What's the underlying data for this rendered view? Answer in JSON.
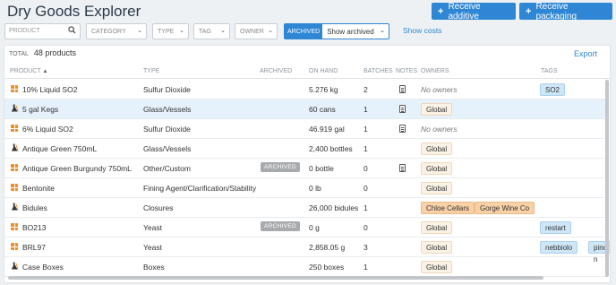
{
  "header": {
    "title": "Dry Goods Explorer",
    "receive_additive": "Receive additive",
    "receive_packaging": "Receive packaging"
  },
  "filters": {
    "search_placeholder": "PRODUCT",
    "category": "CATEGORY",
    "type": "TYPE",
    "tag": "TAG",
    "owner": "OWNER",
    "archived_label": "ARCHIVED",
    "archived_value": "Show archived",
    "show_costs": "Show costs"
  },
  "summary": {
    "total_label": "TOTAL",
    "total_value": "48 products",
    "export": "Export"
  },
  "columns": {
    "product": "PRODUCT",
    "sort_arrow": "▲",
    "type": "TYPE",
    "archived": "ARCHIVED",
    "on_hand": "ON HAND",
    "batches": "BATCHES",
    "notes": "NOTES",
    "owners": "OWNERS",
    "tags": "TAGS"
  },
  "rows": [
    {
      "name": "10% Liquid SO2",
      "icon": "grid-icon",
      "type": "Sulfur Dioxide",
      "archived": "",
      "on_hand": "5.276 kg",
      "batches": "2",
      "note": true,
      "owners": [],
      "no_owners": "No owners",
      "tags": [
        "SO2"
      ]
    },
    {
      "name": "5 gal Kegs",
      "icon": "flask-icon",
      "type": "Glass/Vessels",
      "archived": "",
      "on_hand": "60 cans",
      "batches": "1",
      "note": true,
      "owners": [
        "Global"
      ],
      "tags": []
    },
    {
      "name": "6% Liquid SO2",
      "icon": "grid-icon",
      "type": "Sulfur Dioxide",
      "archived": "",
      "on_hand": "46.919 gal",
      "batches": "1",
      "note": true,
      "owners": [],
      "no_owners": "No owners",
      "tags": []
    },
    {
      "name": "Antique Green 750mL",
      "icon": "flask-icon",
      "type": "Glass/Vessels",
      "archived": "",
      "on_hand": "2,400 bottles",
      "batches": "1",
      "note": false,
      "owners": [
        "Global"
      ],
      "tags": []
    },
    {
      "name": "Antique Green Burgundy 750mL",
      "icon": "grid-icon",
      "type": "Other/Custom",
      "archived": "ARCHIVED",
      "on_hand": "0 bottle",
      "batches": "0",
      "note": true,
      "owners": [
        "Global"
      ],
      "tags": []
    },
    {
      "name": "Bentonite",
      "icon": "grid-icon",
      "type": "Fining Agent/Clarification/Stability",
      "archived": "",
      "on_hand": "0 lb",
      "batches": "0",
      "note": false,
      "owners": [
        "Global"
      ],
      "tags": []
    },
    {
      "name": "Bidules",
      "icon": "flask-icon",
      "type": "Closures",
      "archived": "",
      "on_hand": "26,000 bidules",
      "batches": "1",
      "note": false,
      "owners": [
        "Chloe Cellars",
        "Gorge Wine Co"
      ],
      "tags": []
    },
    {
      "name": "BO213",
      "icon": "grid-icon",
      "type": "Yeast",
      "archived": "ARCHIVED",
      "on_hand": "0 g",
      "batches": "0",
      "note": false,
      "owners": [
        "Global"
      ],
      "tags": [
        "restart"
      ]
    },
    {
      "name": "BRL97",
      "icon": "grid-icon",
      "type": "Yeast",
      "archived": "",
      "on_hand": "2,858.05 g",
      "batches": "3",
      "note": false,
      "owners": [
        "Global"
      ],
      "tags": [
        "nebbiolo",
        "pinot n"
      ]
    },
    {
      "name": "Case Boxes",
      "icon": "flask-icon",
      "type": "Boxes",
      "archived": "",
      "on_hand": "250 boxes",
      "batches": "1",
      "note": false,
      "owners": [
        "Global"
      ],
      "tags": []
    }
  ],
  "colors": {
    "accent": "#2f86d4",
    "icon_orange": "#ee8e2b",
    "owner_global_bg": "#fbf2e6",
    "owner_other_bg": "#f8d1a7",
    "tag_bg": "#cfe6f7",
    "highlight_row": "#e5f1fb"
  }
}
